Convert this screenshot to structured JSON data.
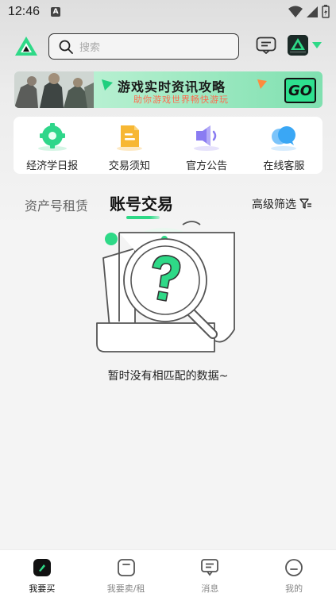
{
  "status_bar": {
    "time": "12:46",
    "notification_letter": "A"
  },
  "header": {
    "search_placeholder": "搜索",
    "icons": [
      "app-logo-icon",
      "search-icon",
      "message-icon",
      "game-avatar",
      "dropdown-caret-icon"
    ]
  },
  "banner": {
    "title": "游戏实时资讯攻略",
    "subtitle": "助你游戏世界畅快游玩",
    "go_label": "GO"
  },
  "quick_links": [
    {
      "label": "经济学日报",
      "icon": "gear-icon",
      "color": "#2fd68a"
    },
    {
      "label": "交易须知",
      "icon": "document-icon",
      "color": "#f7b733"
    },
    {
      "label": "官方公告",
      "icon": "speaker-icon",
      "color": "#8a7cf2"
    },
    {
      "label": "在线客服",
      "icon": "chat-bubble-icon",
      "color": "#3aa7f5"
    }
  ],
  "tabs": {
    "asset_rent": "资产号租赁",
    "account_trade": "账号交易",
    "filter": "高级筛选"
  },
  "empty_state": {
    "message": "暂时没有相匹配的数据~"
  },
  "bottom_nav": [
    {
      "label": "我要买",
      "icon": "buy-icon",
      "active": true
    },
    {
      "label": "我要卖/租",
      "icon": "sell-icon",
      "active": false
    },
    {
      "label": "消息",
      "icon": "message-icon",
      "active": false
    },
    {
      "label": "我的",
      "icon": "profile-icon",
      "active": false
    }
  ],
  "colors": {
    "accent": "#2ed987",
    "text": "#222222",
    "muted": "#888888"
  }
}
